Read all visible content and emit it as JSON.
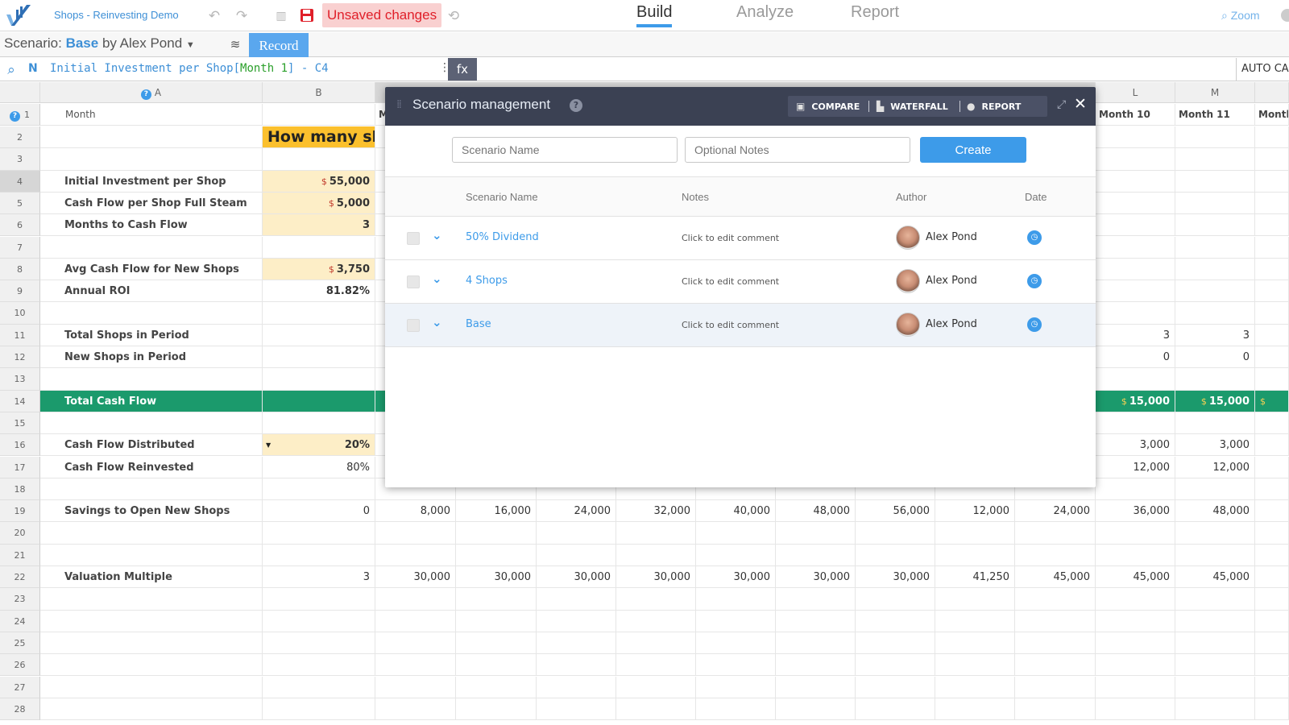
{
  "app": {
    "title": "Shops - Reinvesting Demo",
    "unsaved": "Unsaved changes",
    "modes": [
      "Build",
      "Analyze",
      "Report"
    ],
    "active_mode": "Build",
    "zoom": "Zoom"
  },
  "scenario_bar": {
    "prefix": "Scenario:",
    "name": "Base",
    "by": "by Alex Pond",
    "record": "Record"
  },
  "formula_bar": {
    "n": "N",
    "before": "Initial Investment per Shop[",
    "month": "Month 1",
    "after": "] - C4",
    "fx": "fx",
    "auto_calc": "AUTO CAL"
  },
  "grid": {
    "columns": {
      "A": "A",
      "B": "B",
      "L": "L",
      "M": "M"
    },
    "header_row": {
      "month": "Month",
      "m_partial": "M",
      "l": "Month 10",
      "m": "Month 11",
      "n": "Month"
    },
    "banner": "How many sh",
    "rows": [
      {
        "num": "2"
      },
      {
        "num": "3"
      },
      {
        "num": "4",
        "label": "Initial Investment per Shop",
        "b": "55,000",
        "dollar": "$"
      },
      {
        "num": "5",
        "label": "Cash Flow per Shop Full Steam",
        "b": "5,000",
        "dollar": "$"
      },
      {
        "num": "6",
        "label": "Months to Cash Flow",
        "b": "3"
      },
      {
        "num": "7"
      },
      {
        "num": "8",
        "label": "Avg Cash Flow for New Shops",
        "b": "3,750",
        "dollar": "$"
      },
      {
        "num": "9",
        "label": "Annual ROI",
        "b": "81.82%"
      },
      {
        "num": "10"
      },
      {
        "num": "11",
        "label": "Total Shops in Period",
        "l": "3",
        "m": "3"
      },
      {
        "num": "12",
        "label": "New Shops in Period",
        "l": "0",
        "m": "0"
      },
      {
        "num": "13"
      },
      {
        "num": "14",
        "label": "Total Cash Flow",
        "l": "15,000",
        "m": "15,000",
        "dollar": "$"
      },
      {
        "num": "15"
      },
      {
        "num": "16",
        "label": "Cash Flow Distributed",
        "b": "20%",
        "l": "3,000",
        "m": "3,000"
      },
      {
        "num": "17",
        "label": "Cash Flow Reinvested",
        "b": "80%",
        "l": "12,000",
        "m": "12,000"
      },
      {
        "num": "18"
      },
      {
        "num": "19",
        "label": "Savings to Open New Shops",
        "values": [
          "0",
          "8,000",
          "16,000",
          "24,000",
          "32,000",
          "40,000",
          "48,000",
          "56,000",
          "12,000",
          "24,000",
          "36,000",
          "48,000"
        ]
      },
      {
        "num": "20"
      },
      {
        "num": "21"
      },
      {
        "num": "22",
        "label": "Valuation Multiple",
        "values": [
          "3",
          "30,000",
          "30,000",
          "30,000",
          "30,000",
          "30,000",
          "30,000",
          "30,000",
          "41,250",
          "45,000",
          "45,000",
          "45,000"
        ]
      },
      {
        "num": "23"
      },
      {
        "num": "24"
      },
      {
        "num": "25"
      },
      {
        "num": "26"
      },
      {
        "num": "27"
      },
      {
        "num": "28"
      }
    ]
  },
  "modal": {
    "title": "Scenario management",
    "tabs": {
      "compare": "COMPARE",
      "waterfall": "WATERFALL",
      "report": "REPORT"
    },
    "name_placeholder": "Scenario Name",
    "notes_placeholder": "Optional Notes",
    "create": "Create",
    "headers": {
      "name": "Scenario Name",
      "notes": "Notes",
      "author": "Author",
      "date": "Date"
    },
    "scenarios": [
      {
        "name": "50% Dividend",
        "note": "Click to edit comment",
        "author": "Alex Pond"
      },
      {
        "name": "4 Shops",
        "note": "Click to edit comment",
        "author": "Alex Pond"
      },
      {
        "name": "Base",
        "note": "Click to edit comment",
        "author": "Alex Pond"
      }
    ]
  }
}
